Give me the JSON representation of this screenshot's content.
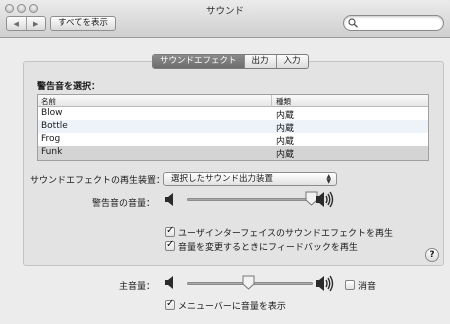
{
  "window": {
    "title": "サウンド",
    "show_all_label": "すべてを表示"
  },
  "tabs": [
    {
      "label": "サウンドエフェクト",
      "active": true
    },
    {
      "label": "出力",
      "active": false
    },
    {
      "label": "入力",
      "active": false
    }
  ],
  "alerts": {
    "heading": "警告音を選択：",
    "columns": [
      "名前",
      "種類"
    ],
    "rows": [
      {
        "name": "Blow",
        "type": "内蔵"
      },
      {
        "name": "Bottle",
        "type": "内蔵"
      },
      {
        "name": "Frog",
        "type": "内蔵"
      },
      {
        "name": "Funk",
        "type": "内蔵",
        "selected": true
      }
    ]
  },
  "playback": {
    "label": "サウンドエフェクトの再生装置：",
    "selected": "選択したサウンド出力装置"
  },
  "alert_volume": {
    "label": "警告音の音量：",
    "level": 1.0
  },
  "options": {
    "ui_effects_label": "ユーザインターフェイスのサウンドエフェクトを再生",
    "ui_effects_checked": true,
    "feedback_label": "音量を変更するときにフィードバックを再生",
    "feedback_checked": true
  },
  "main_volume": {
    "label": "主音量：",
    "level": 0.5,
    "mute_label": "消音",
    "mute_checked": false,
    "menubar_label": "メニューバーに音量を表示",
    "menubar_checked": true
  },
  "help_label": "?",
  "icons": {
    "back": "left-arrow-icon",
    "forward": "right-arrow-icon",
    "search": "search-icon",
    "speaker": "speaker-icon"
  }
}
